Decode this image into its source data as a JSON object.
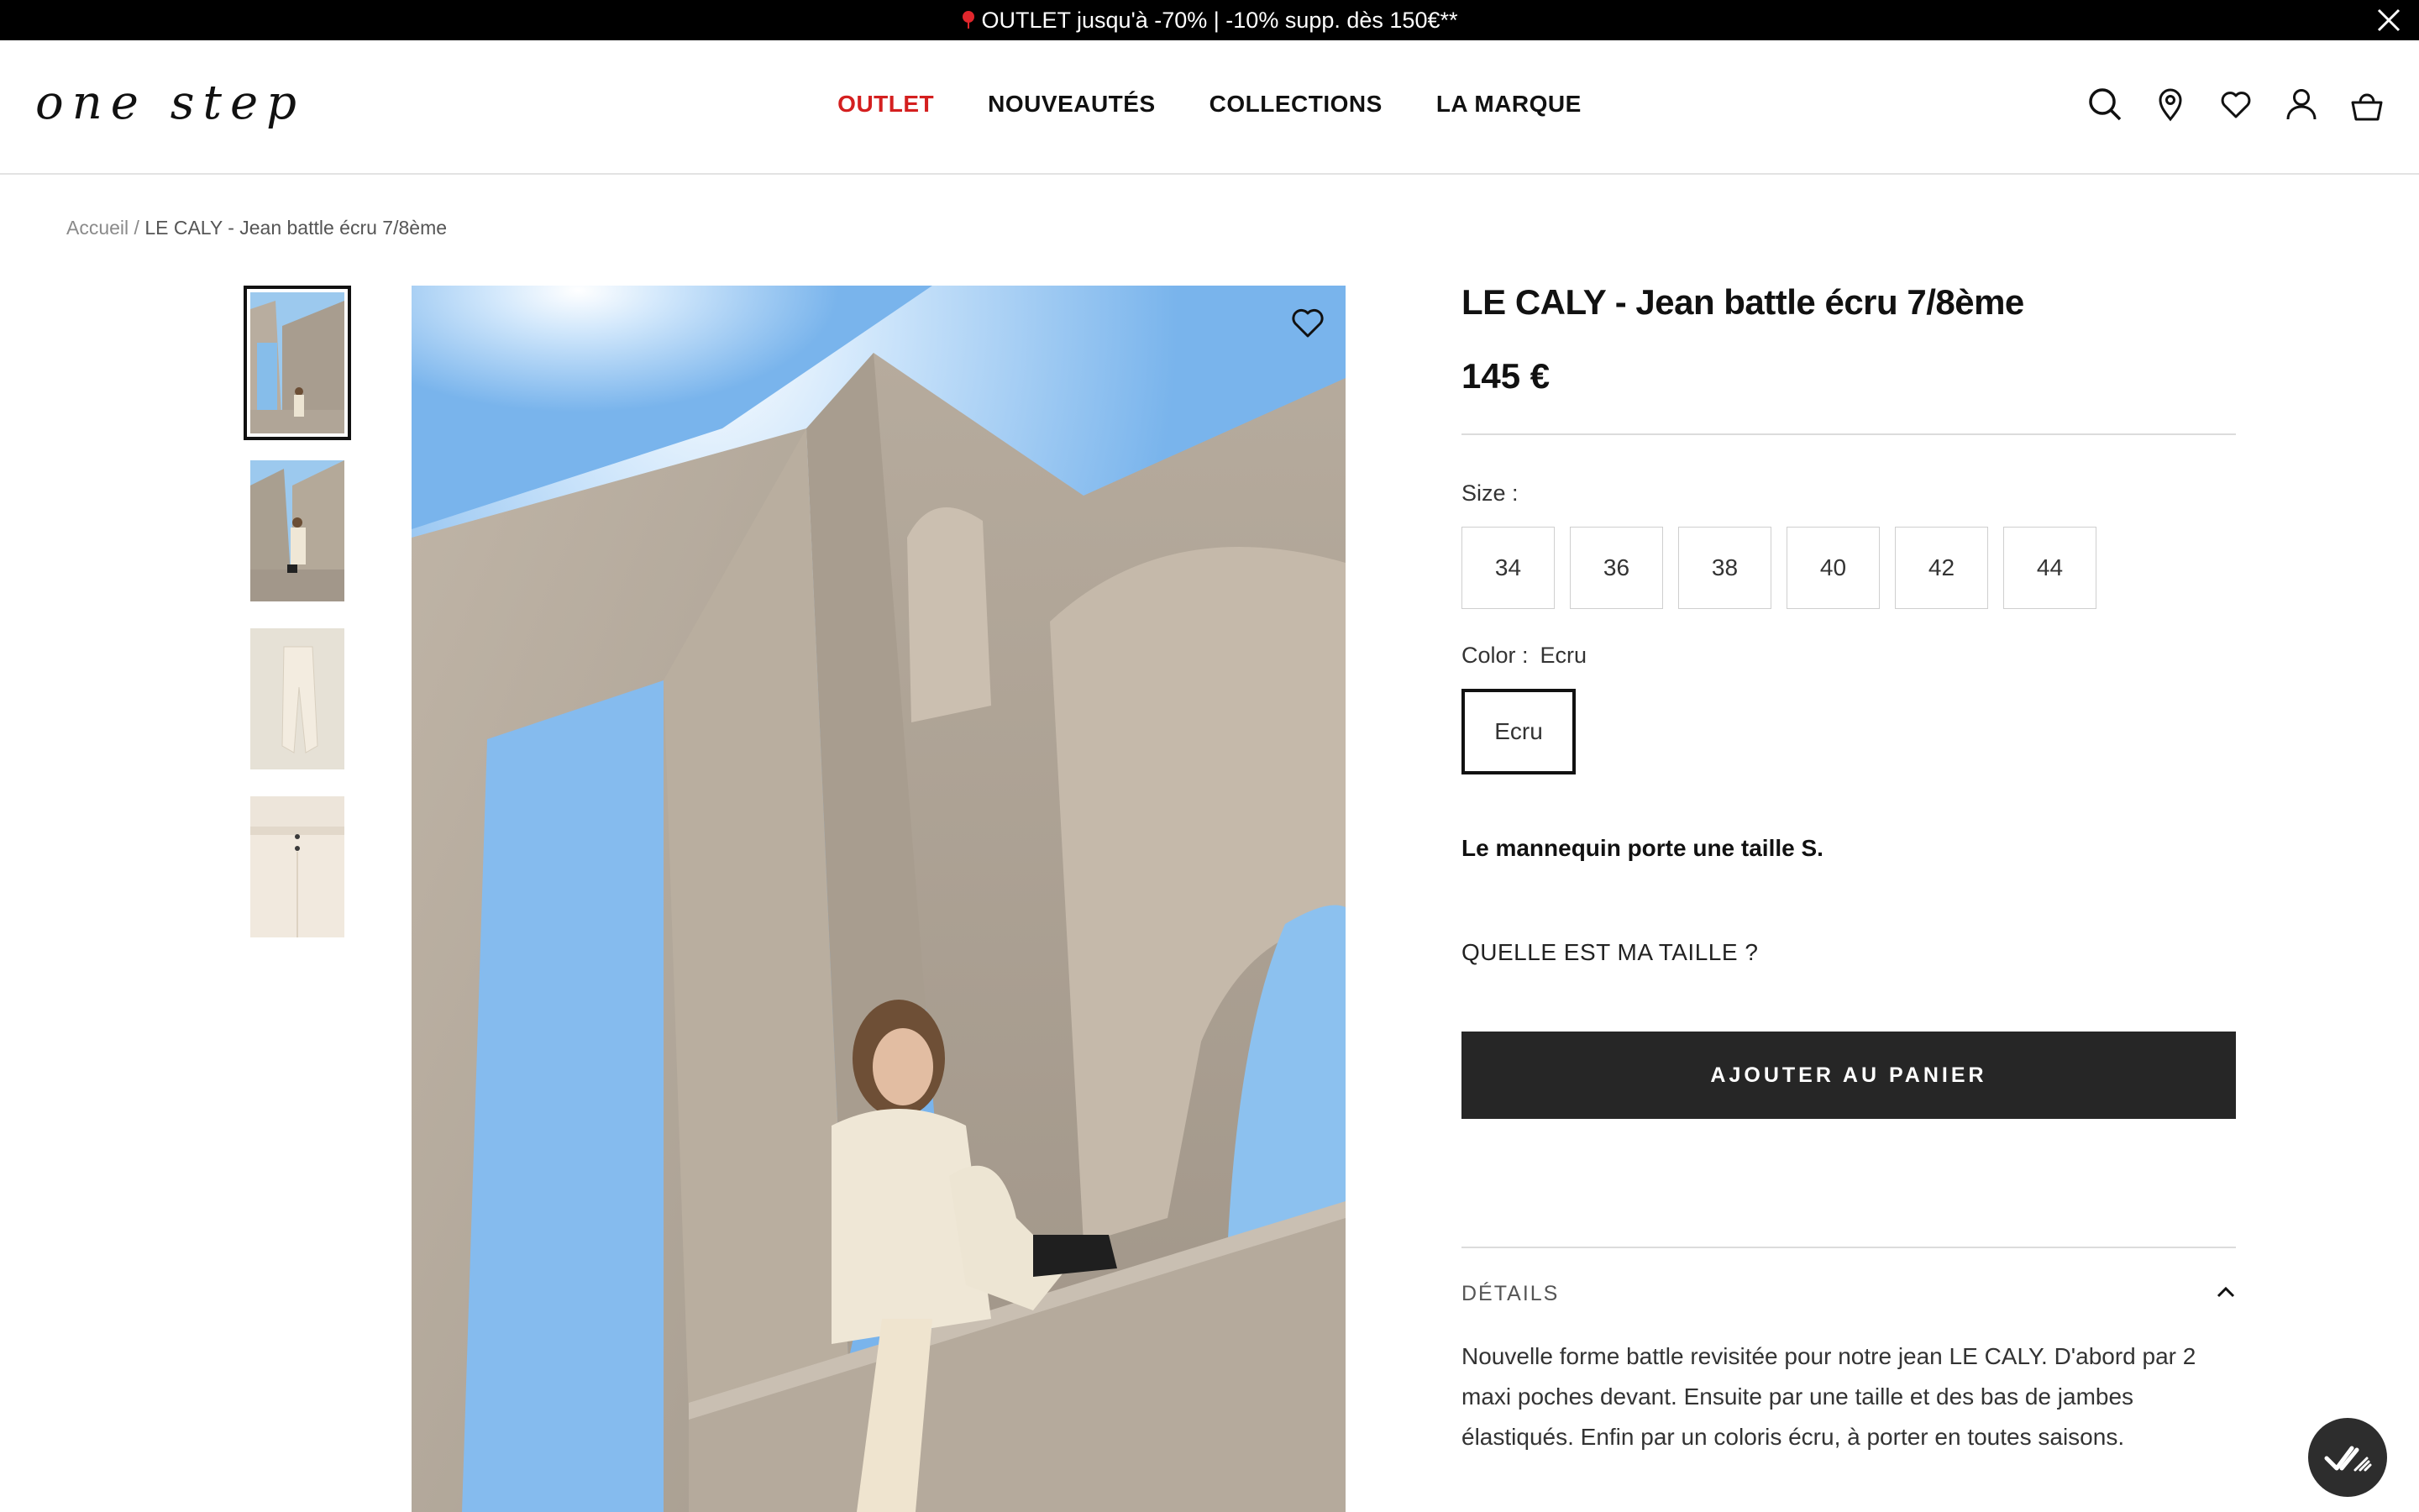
{
  "promo": {
    "text": "OUTLET jusqu'à -70% | -10% supp. dès 150€**"
  },
  "header": {
    "logo": "one step",
    "nav": [
      {
        "label": "OUTLET",
        "color": "#d41f1f"
      },
      {
        "label": "NOUVEAUTÉS"
      },
      {
        "label": "COLLECTIONS"
      },
      {
        "label": "LA MARQUE"
      }
    ],
    "icons": [
      "search-icon",
      "store-locator-icon",
      "wishlist-icon",
      "account-icon",
      "cart-icon"
    ]
  },
  "breadcrumb": {
    "home": "Accueil",
    "separator": "/",
    "current": "LE CALY - Jean battle écru 7/8ème"
  },
  "gallery": {
    "thumbnail_count": 4,
    "active_index": 0
  },
  "product": {
    "title": "LE CALY - Jean battle écru 7/8ème",
    "price": "145 €",
    "size_label": "Size :",
    "sizes": [
      "34",
      "36",
      "38",
      "40",
      "42",
      "44"
    ],
    "color_label": "Color :",
    "color_value": "Ecru",
    "color_option": "Ecru",
    "model_info": "Le mannequin porte une taille S.",
    "size_guide": "QUELLE EST MA TAILLE ?",
    "add_to_cart": "AJOUTER AU PANIER",
    "details_label": "DÉTAILS",
    "details_text": "Nouvelle forme battle revisitée pour notre jean LE CALY. D'abord par 2 maxi poches devant. Ensuite par une taille et des bas de jambes élastiqués. Enfin par un coloris écru, à porter en toutes saisons."
  },
  "colors": {
    "accent_red": "#d41f1f",
    "button_dark": "#262626"
  }
}
